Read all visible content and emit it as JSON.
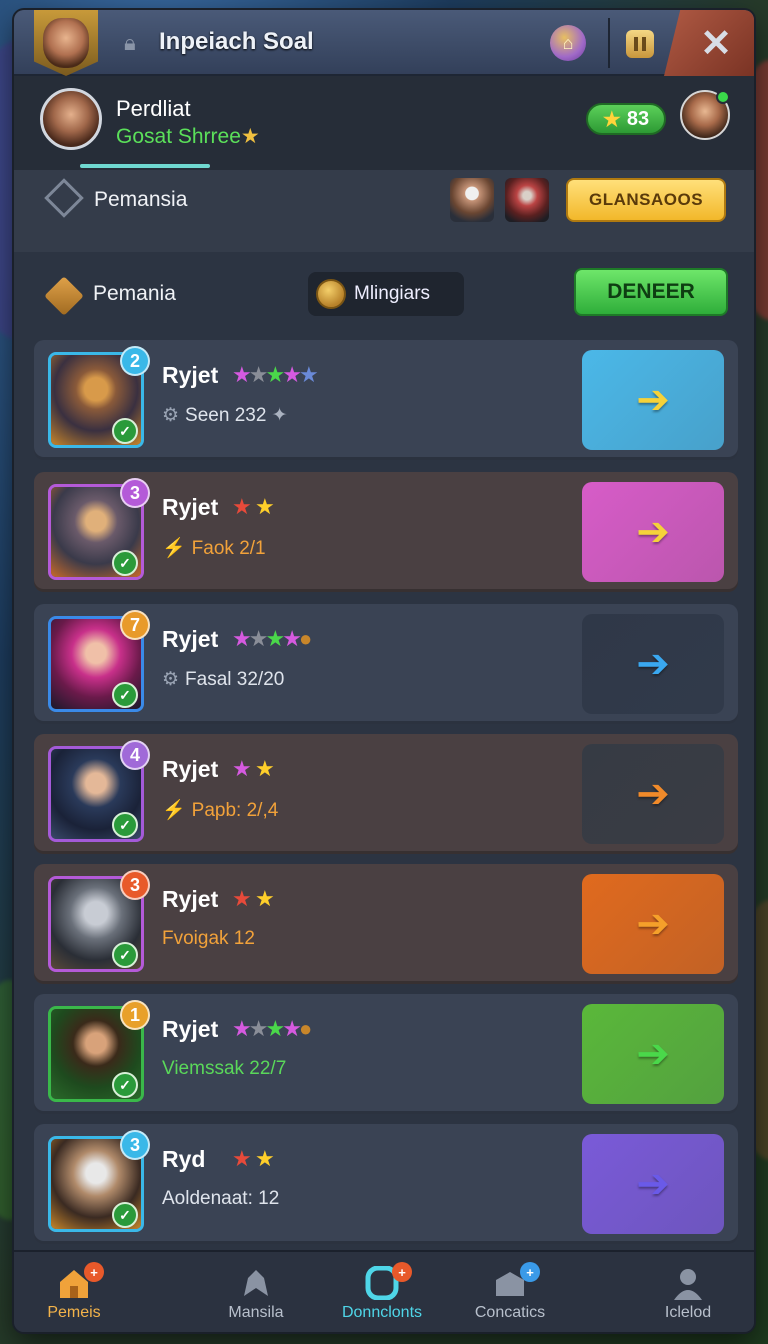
{
  "window": {
    "title": "Inpeiach Soal",
    "close_label": "✕"
  },
  "profile": {
    "name": "Perdliat",
    "subtitle": "Gosat Shrree",
    "score": "83"
  },
  "bar1": {
    "label": "Pemansia",
    "button_label": "GLANSAOOS"
  },
  "bar2": {
    "label": "Pemania",
    "chip_label": "Mlingiars",
    "button_label": "DENEER"
  },
  "rows": [
    {
      "name": "Ryjet",
      "level": "2",
      "stars": "★★★★★",
      "stat": "Seen 232",
      "stat_suffix": " ✦",
      "tile_color": "#4bb8e8",
      "glyph_color": "#f5d23a"
    },
    {
      "name": "Ryjet",
      "level": "3",
      "stars": "★ ★",
      "stat": "Faok 2/1",
      "stat_suffix": "",
      "tile_color": "#d75cc8",
      "glyph_color": "#f5d23a"
    },
    {
      "name": "Ryjet",
      "level": "7",
      "stars": "★★★★●",
      "stat": "Fasal 32/20",
      "stat_suffix": "",
      "tile_color": "#2f3848",
      "glyph_color": "#3aa8f0"
    },
    {
      "name": "Ryjet",
      "level": "4",
      "stars": "★ ★",
      "stat": "Papb: 2/,4",
      "stat_suffix": "",
      "tile_color": "#363b44",
      "glyph_color": "#f08a2a"
    },
    {
      "name": "Ryjet",
      "level": "3",
      "stars": "★ ★",
      "stat": "Fvoigak 12",
      "stat_suffix": "",
      "tile_color": "#e06a1e",
      "glyph_color": "#f5a02a"
    },
    {
      "name": "Ryjet",
      "level": "1",
      "stars": "★★★★●",
      "stat": "Viemssak 22/7",
      "stat_suffix": "",
      "tile_color": "#5ab83a",
      "glyph_color": "#4ad84a"
    },
    {
      "name": "Ryd",
      "level": "3",
      "stars": "★ ★",
      "stat": "Aoldenaat: 12",
      "stat_suffix": "",
      "tile_color": "#7a5ad8",
      "glyph_color": "#6a5ae8"
    }
  ],
  "nav": [
    {
      "label": "Pemeis",
      "icon": "home-icon"
    },
    {
      "label": "Mansila",
      "icon": "dragon-icon"
    },
    {
      "label": "Donnclonts",
      "icon": "ring-icon"
    },
    {
      "label": "Concatics",
      "icon": "cart-icon"
    },
    {
      "label": "Iclelod",
      "icon": "person-icon"
    }
  ],
  "colors": {
    "accent": "#4fd6e8",
    "green": "#3dbd45",
    "gold": "#f2b82a"
  }
}
